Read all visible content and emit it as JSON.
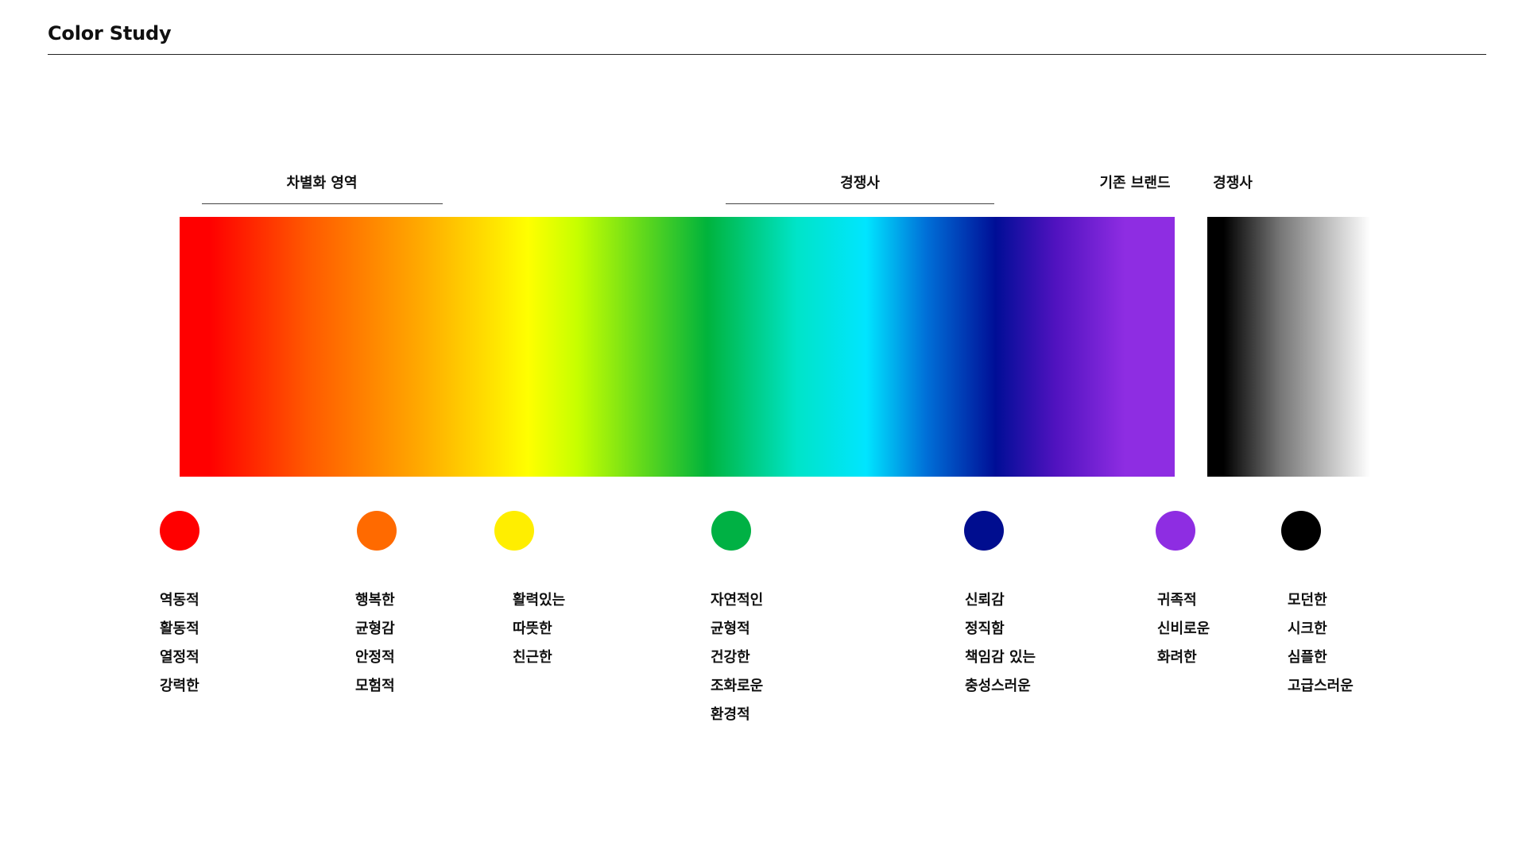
{
  "title": "Color Study",
  "regions": [
    {
      "label": "차별화 영역"
    },
    {
      "label": "경쟁사"
    },
    {
      "label": "기존 브랜드"
    },
    {
      "label": "경쟁사"
    }
  ],
  "spectrum_stops": [
    {
      "color": "#ff0000",
      "pos": 0.03
    },
    {
      "color": "#ff5a00",
      "pos": 0.13
    },
    {
      "color": "#ffa800",
      "pos": 0.24
    },
    {
      "color": "#ffff00",
      "pos": 0.35
    },
    {
      "color": "#c6ff00",
      "pos": 0.4
    },
    {
      "color": "#5ad61e",
      "pos": 0.47
    },
    {
      "color": "#00b33c",
      "pos": 0.53
    },
    {
      "color": "#00e4c8",
      "pos": 0.62
    },
    {
      "color": "#00e5ff",
      "pos": 0.69
    },
    {
      "color": "#0070d8",
      "pos": 0.75
    },
    {
      "color": "#000e96",
      "pos": 0.82
    },
    {
      "color": "#5012bf",
      "pos": 0.88
    },
    {
      "color": "#8e2de2",
      "pos": 0.95
    }
  ],
  "mono_stops": [
    {
      "color": "#000000",
      "pos": 0.1
    },
    {
      "color": "#777777",
      "pos": 0.45
    },
    {
      "color": "#ffffff",
      "pos": 1.0
    }
  ],
  "swatches": [
    {
      "color": "#ff0000",
      "words": [
        "역동적",
        "활동적",
        "열정적",
        "강력한"
      ]
    },
    {
      "color": "#ff6a00",
      "words": [
        "행복한",
        "균형감",
        "안정적",
        "모험적"
      ]
    },
    {
      "color": "#ffee00",
      "words": [
        "활력있는",
        "따뜻한",
        "친근한"
      ]
    },
    {
      "color": "#00b144",
      "words": [
        "자연적인",
        "균형적",
        "건강한",
        "조화로운",
        "환경적"
      ]
    },
    {
      "color": "#000d8f",
      "words": [
        "신뢰감",
        "정직함",
        "책임감 있는",
        "충성스러운"
      ]
    },
    {
      "color": "#8e2de2",
      "words": [
        "귀족적",
        "신비로운",
        "화려한"
      ]
    },
    {
      "color": "#000000",
      "words": [
        "모던한",
        "시크한",
        "심플한",
        "고급스러운"
      ]
    }
  ]
}
